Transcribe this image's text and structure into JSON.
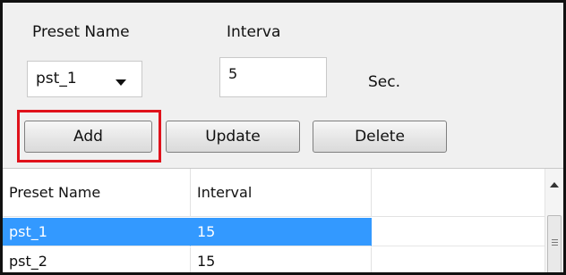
{
  "form": {
    "preset_name_label": "Preset Name",
    "interval_label": "Interva",
    "preset_select_value": "pst_1",
    "interval_value": "5",
    "unit_label": "Sec."
  },
  "buttons": {
    "add": "Add",
    "update": "Update",
    "delete": "Delete"
  },
  "highlight_color": "#e0121b",
  "table": {
    "columns": [
      "Preset Name",
      "Interval",
      ""
    ],
    "rows": [
      {
        "name": "pst_1",
        "interval": "15",
        "selected": true
      },
      {
        "name": "pst_2",
        "interval": "15",
        "selected": false
      }
    ],
    "selection_color": "#3399ff"
  }
}
